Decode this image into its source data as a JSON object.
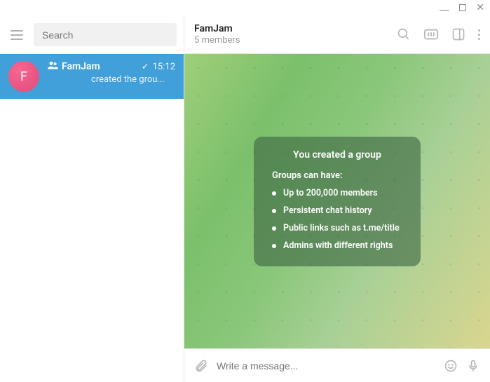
{
  "sidebar": {
    "search_placeholder": "Search",
    "chat": {
      "avatar_letter": "F",
      "name": "FamJam",
      "time": "15:12",
      "preview_suffix": "created the grou..."
    }
  },
  "header": {
    "title": "FamJam",
    "subtitle": "5 members"
  },
  "info_card": {
    "title": "You created a group",
    "subtitle": "Groups can have:",
    "items": [
      "Up to 200,000 members",
      "Persistent chat history",
      "Public links such as t.me/title",
      "Admins with different rights"
    ]
  },
  "composer": {
    "placeholder": "Write a message..."
  }
}
